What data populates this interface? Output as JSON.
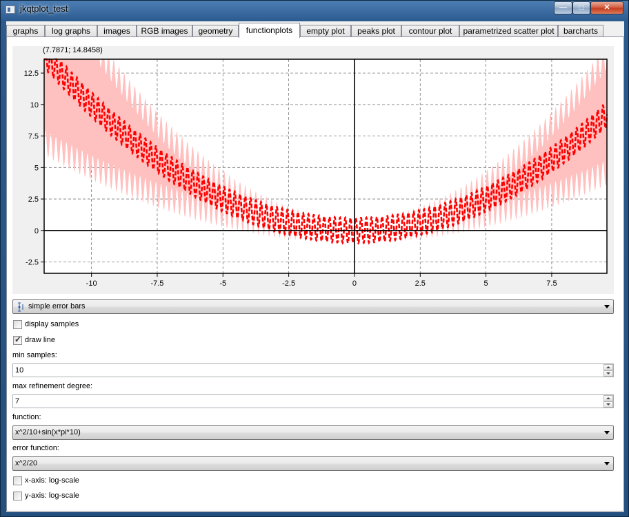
{
  "window": {
    "title": "jkqtplot_test"
  },
  "window_buttons": {
    "minimize": "—",
    "maximize": "□",
    "close": "✕"
  },
  "tabs": [
    {
      "label": "graphs"
    },
    {
      "label": "log graphs"
    },
    {
      "label": "images"
    },
    {
      "label": "RGB images"
    },
    {
      "label": "geometry"
    },
    {
      "label": "functionplots",
      "active": true
    },
    {
      "label": "empty plot"
    },
    {
      "label": "peaks plot"
    },
    {
      "label": "contour plot"
    },
    {
      "label": "parametrized scatter plot"
    },
    {
      "label": "barcharts"
    }
  ],
  "plot": {
    "coordinate_readout": "(7.7871; 14.8458)"
  },
  "controls": {
    "error_style": {
      "value": "simple error bars",
      "icon": "error-bars-icon"
    },
    "display_samples": {
      "label": "display samples",
      "checked": false
    },
    "draw_line": {
      "label": "draw line",
      "checked": true
    },
    "min_samples": {
      "label": "min samples:",
      "value": "10"
    },
    "max_refinement": {
      "label": "max refinement degree:",
      "value": "7"
    },
    "function": {
      "label": "function:",
      "value": "x^2/10+sin(x*pi*10)"
    },
    "error_function": {
      "label": "error function:",
      "value": "x^2/20"
    },
    "x_log": {
      "label": "x-axis: log-scale",
      "checked": false
    },
    "y_log": {
      "label": "y-axis: log-scale",
      "checked": false
    }
  },
  "chart_data": {
    "type": "line",
    "function": "x^2/10+sin(x*pi*10)",
    "error_function": "x^2/20",
    "xlim": [
      -11.8,
      9.6
    ],
    "ylim": [
      -3.4,
      13.6
    ],
    "x_ticks": [
      -10,
      -7.5,
      -5,
      -2.5,
      0,
      2.5,
      5,
      7.5
    ],
    "x_tick_labels": [
      "-10",
      "-7.5",
      "-5",
      "-2.5",
      "0",
      "2.5",
      "5",
      "7.5"
    ],
    "y_ticks": [
      -2.5,
      0,
      2.5,
      5,
      7.5,
      10,
      12.5
    ],
    "y_tick_labels": [
      "-2.5",
      "0",
      "2.5",
      "5",
      "7.5",
      "10",
      "12.5"
    ],
    "grid": true,
    "series": [
      {
        "color": "#ff0000",
        "line_style": "dashed",
        "error_color": "#ffc0c0"
      }
    ]
  }
}
